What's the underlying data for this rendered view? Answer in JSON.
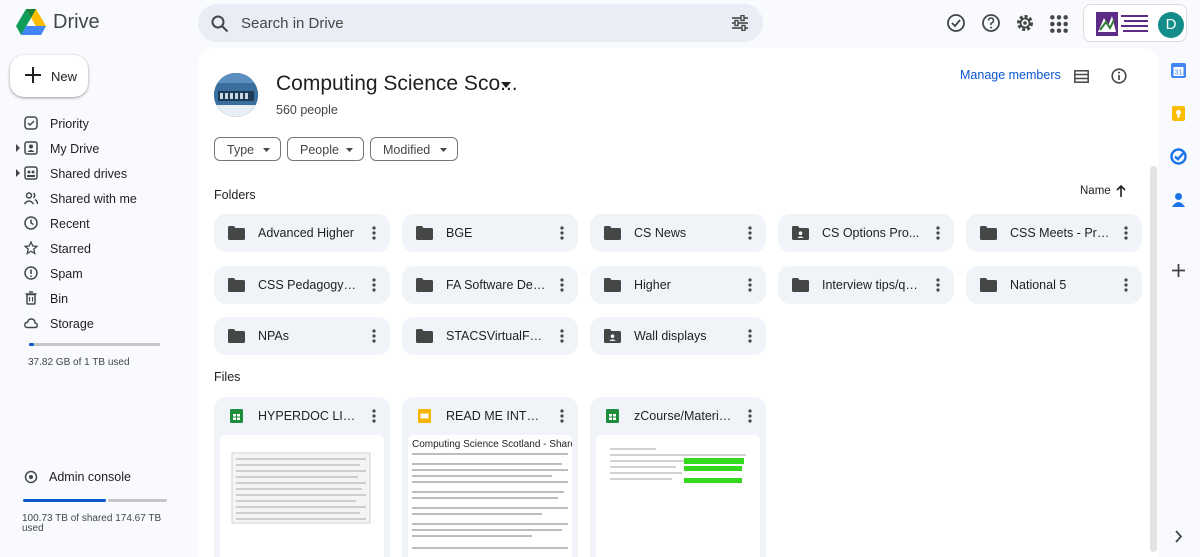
{
  "app": {
    "name": "Drive"
  },
  "search": {
    "placeholder": "Search in Drive"
  },
  "header_icons": [
    "ready-for-offline-icon",
    "help-icon",
    "settings-icon",
    "apps-grid-icon"
  ],
  "account": {
    "initial": "D",
    "avatar_color": "#138d8a"
  },
  "new_button": {
    "label": "New"
  },
  "nav": [
    {
      "label": "Priority",
      "icon": "priority-icon"
    },
    {
      "label": "My Drive",
      "icon": "my-drive-icon",
      "expandable": true
    },
    {
      "label": "Shared drives",
      "icon": "shared-drives-icon",
      "expandable": true
    },
    {
      "label": "Shared with me",
      "icon": "shared-with-me-icon"
    },
    {
      "label": "Recent",
      "icon": "clock-icon"
    },
    {
      "label": "Starred",
      "icon": "star-icon"
    },
    {
      "label": "Spam",
      "icon": "spam-icon"
    },
    {
      "label": "Bin",
      "icon": "trash-icon"
    },
    {
      "label": "Storage",
      "icon": "cloud-icon"
    }
  ],
  "storage": {
    "text": "37.82 GB of 1 TB used",
    "used_fraction": 0.037
  },
  "admin": {
    "label": "Admin console"
  },
  "shared_storage": {
    "text": "100.73 TB of shared 174.67 TB used",
    "used_fraction": 0.577
  },
  "drive": {
    "title": "Computing Science Sco...",
    "members": "560 people",
    "manage_label": "Manage members"
  },
  "filters": [
    "Type",
    "People",
    "Modified"
  ],
  "folders_heading": "Folders",
  "sort": {
    "label": "Name"
  },
  "folders": [
    {
      "name": "Advanced Higher",
      "shared": false
    },
    {
      "name": "BGE",
      "shared": false
    },
    {
      "name": "CS News",
      "shared": false
    },
    {
      "name": "CS Options Pro...",
      "shared": true
    },
    {
      "name": "CSS Meets - Pre...",
      "shared": false
    },
    {
      "name": "CSS Pedagogy L...",
      "shared": false
    },
    {
      "name": "FA Software Dev...",
      "shared": false
    },
    {
      "name": "Higher",
      "shared": false
    },
    {
      "name": "Interview tips/qu...",
      "shared": false
    },
    {
      "name": "National 5",
      "shared": false
    },
    {
      "name": "NPAs",
      "shared": false
    },
    {
      "name": "STACSVirtualFe...",
      "shared": false
    },
    {
      "name": "Wall displays",
      "shared": true
    }
  ],
  "files_heading": "Files",
  "files": [
    {
      "name": "HYPERDOC LIN...",
      "type": "sheet"
    },
    {
      "name": "READ ME INTRO...",
      "type": "slides",
      "preview_title": "Computing Science Scotland - Shared Drive"
    },
    {
      "name": "zCourse/Materia...",
      "type": "sheet"
    }
  ],
  "colors": {
    "accent": "#0b57d0",
    "sheets": "#1e8e3e",
    "slides": "#f4b400",
    "surface": "#f0f4f9"
  }
}
